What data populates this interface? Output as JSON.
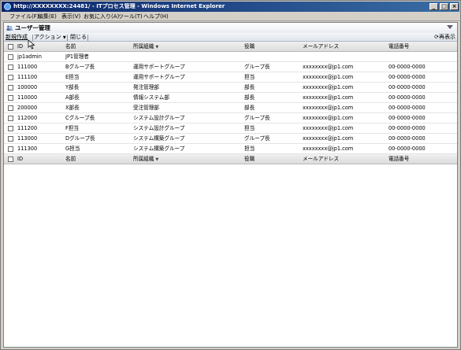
{
  "window": {
    "title": "http://XXXXXXXX:24481/ - ITプロセス管理 - Windows Internet Explorer",
    "min_label": "_",
    "max_label": "□",
    "close_label": "×"
  },
  "menubar": {
    "items": [
      {
        "label": "ファイル(F)"
      },
      {
        "label": "編集(E)"
      },
      {
        "label": "表示(V)"
      },
      {
        "label": "お気に入り(A)"
      },
      {
        "label": "ツール(T)"
      },
      {
        "label": "ヘルプ(H)"
      }
    ]
  },
  "page": {
    "title": "ユーザー管理"
  },
  "toolbar": {
    "new_label": "新規作成",
    "action_label": "アクション",
    "close_label": "閉じる",
    "refresh_label": "再表示"
  },
  "table": {
    "headers": {
      "id": "ID",
      "name": "名前",
      "org": "所属組織",
      "role": "役職",
      "mail": "メールアドレス",
      "tel": "電話番号"
    },
    "rows": [
      {
        "id": "jp1admin",
        "name": "JP1管理者",
        "org": "",
        "role": "",
        "mail": "",
        "tel": ""
      },
      {
        "id": "111000",
        "name": "Bグループ長",
        "org": "運用サポートグループ",
        "role": "グループ長",
        "mail": "xxxxxxxx@jp1.com",
        "tel": "00-0000-0000"
      },
      {
        "id": "111100",
        "name": "E担当",
        "org": "運用サポートグループ",
        "role": "担当",
        "mail": "xxxxxxxx@jp1.com",
        "tel": "00-0000-0000"
      },
      {
        "id": "100000",
        "name": "Y部長",
        "org": "発注管理部",
        "role": "部長",
        "mail": "xxxxxxxx@jp1.com",
        "tel": "00-0000-0000"
      },
      {
        "id": "110000",
        "name": "A部長",
        "org": "情報システム部",
        "role": "部長",
        "mail": "xxxxxxxx@jp1.com",
        "tel": "00-0000-0000"
      },
      {
        "id": "200000",
        "name": "X部長",
        "org": "受注管理部",
        "role": "部長",
        "mail": "xxxxxxxx@jp1.com",
        "tel": "00-0000-0000"
      },
      {
        "id": "112000",
        "name": "Cグループ長",
        "org": "システム設計グループ",
        "role": "グループ長",
        "mail": "xxxxxxxx@jp1.com",
        "tel": "00-0000-0000"
      },
      {
        "id": "111200",
        "name": "F担当",
        "org": "システム設計グループ",
        "role": "担当",
        "mail": "xxxxxxxx@jp1.com",
        "tel": "00-0000-0000"
      },
      {
        "id": "113000",
        "name": "Dグループ長",
        "org": "システム構築グループ",
        "role": "グループ長",
        "mail": "xxxxxxxx@jp1.com",
        "tel": "00-0000-0000"
      },
      {
        "id": "111300",
        "name": "G担当",
        "org": "システム構築グループ",
        "role": "担当",
        "mail": "xxxxxxxx@jp1.com",
        "tel": "00-0000-0000"
      }
    ]
  }
}
